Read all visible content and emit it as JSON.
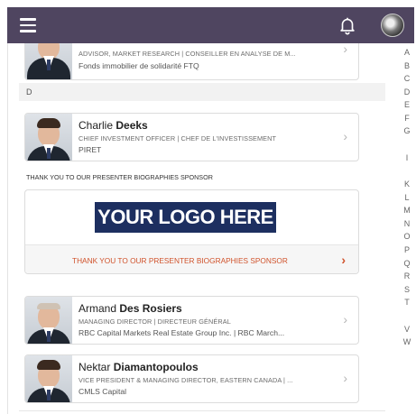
{
  "topbar": {
    "menu_icon": "hamburger-icon",
    "notification_icon": "bell-icon",
    "avatar": "user-avatar"
  },
  "cards": [
    {
      "first_name": "",
      "last_name": "",
      "role": "ADVISOR, MARKET RESEARCH | CONSEILLER EN ANALYSE DE M...",
      "org": "Fonds immobilier de solidarité FTQ"
    },
    {
      "first_name": "Charlie ",
      "last_name": "Deeks",
      "role": "CHIEF INVESTMENT OFFICER | CHEF DE L'INVESTISSEMENT",
      "org": "PIRET"
    },
    {
      "first_name": "Armand ",
      "last_name": "Des Rosiers",
      "role": "MANAGING DIRECTOR | DIRECTEUR GÉNÉRAL",
      "org": "RBC Capital Markets Real Estate Group Inc. | RBC March..."
    },
    {
      "first_name": "Nektar ",
      "last_name": "Diamantopoulos",
      "role": "VICE PRESIDENT & MANAGING DIRECTOR, EASTERN CANADA | ...",
      "org": "CMLS Capital"
    }
  ],
  "section_letter": "D",
  "sponsor": {
    "label": "THANK YOU TO OUR PRESENTER BIOGRAPHIES SPONSOR",
    "logo_text": "YOUR LOGO HERE",
    "footer_text": "THANK YOU TO OUR PRESENTER BIOGRAPHIES SPONSOR",
    "accent_color": "#d0522b",
    "logo_color": "#1d2f60"
  },
  "alphabet": [
    "A",
    "B",
    "C",
    "D",
    "E",
    "F",
    "G",
    "I",
    "K",
    "L",
    "M",
    "N",
    "O",
    "P",
    "Q",
    "R",
    "S",
    "T",
    "V",
    "W"
  ],
  "colors": {
    "topbar": "#4f4560"
  }
}
